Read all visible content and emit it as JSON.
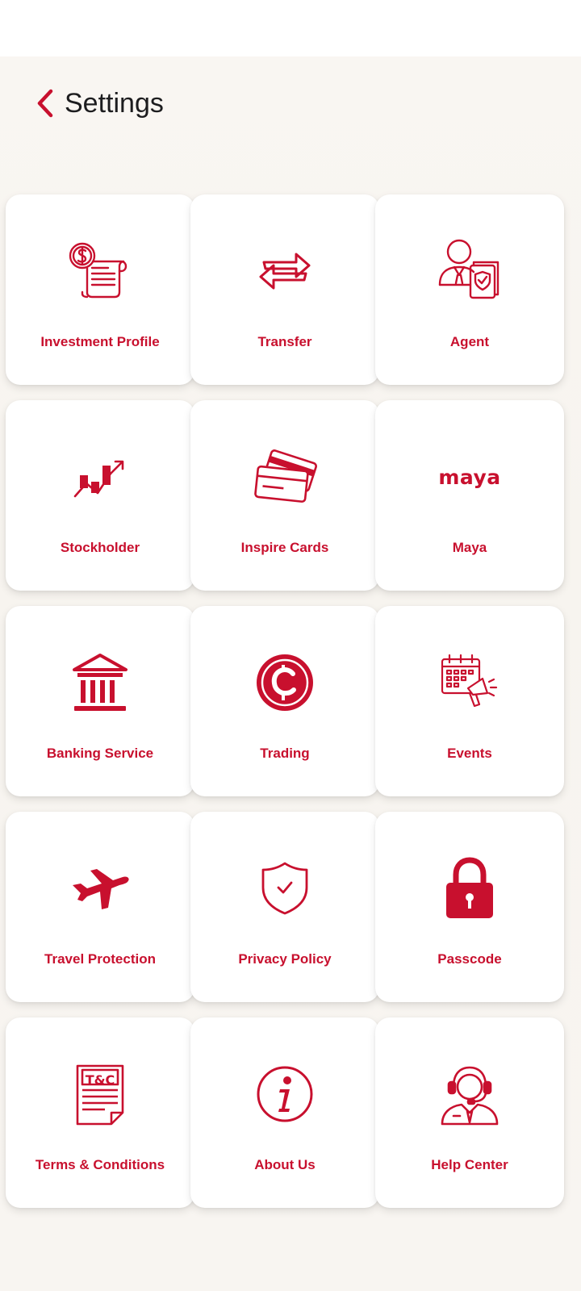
{
  "header": {
    "title": "Settings",
    "back_icon": "chevron-left-icon"
  },
  "colors": {
    "accent": "#c8102e",
    "background": "#f8f5f1",
    "tile": "#ffffff",
    "title_text": "#1d1d1f"
  },
  "tiles": [
    {
      "label": "Investment Profile",
      "icon": "dollar-receipt-icon"
    },
    {
      "label": "Transfer",
      "icon": "transfer-arrows-icon"
    },
    {
      "label": "Agent",
      "icon": "agent-shield-icon"
    },
    {
      "label": "Stockholder",
      "icon": "stock-chart-icon"
    },
    {
      "label": "Inspire Cards",
      "icon": "credit-cards-icon"
    },
    {
      "label": "Maya",
      "icon": "maya-logo-icon",
      "logo_text": "maya"
    },
    {
      "label": "Banking Service",
      "icon": "bank-building-icon"
    },
    {
      "label": "Trading",
      "icon": "crypto-coin-icon"
    },
    {
      "label": "Events",
      "icon": "calendar-megaphone-icon"
    },
    {
      "label": "Travel Protection",
      "icon": "airplane-icon"
    },
    {
      "label": "Privacy Policy",
      "icon": "shield-check-icon"
    },
    {
      "label": "Passcode",
      "icon": "padlock-icon"
    },
    {
      "label": "Terms & Conditions",
      "icon": "terms-document-icon",
      "icon_text": "T&C"
    },
    {
      "label": "About Us",
      "icon": "info-circle-icon"
    },
    {
      "label": "Help Center",
      "icon": "headset-agent-icon"
    }
  ]
}
